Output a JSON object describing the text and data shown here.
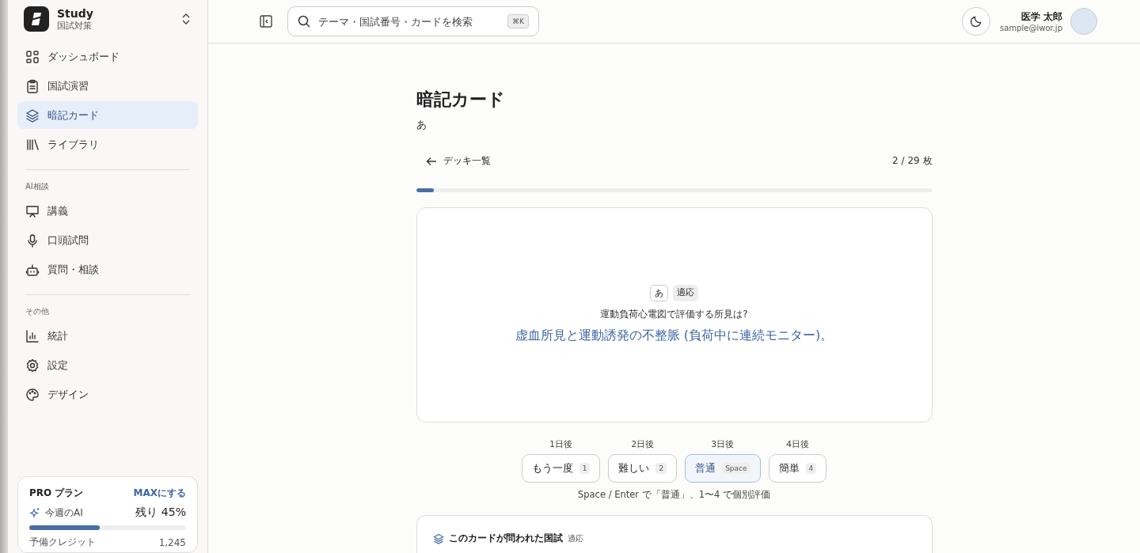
{
  "workspace": {
    "name": "Study",
    "subtitle": "国試対策"
  },
  "sidebar": {
    "sections": [
      {
        "items": [
          {
            "label": "ダッシュボード",
            "selected": false
          },
          {
            "label": "国試演習",
            "selected": false
          },
          {
            "label": "暗記カード",
            "selected": true
          },
          {
            "label": "ライブラリ",
            "selected": false
          }
        ]
      },
      {
        "heading": "AI相談",
        "items": [
          {
            "label": "講義",
            "selected": false
          },
          {
            "label": "口頭試問",
            "selected": false
          },
          {
            "label": "質問・相談",
            "selected": false
          }
        ]
      },
      {
        "heading": "その他",
        "items": [
          {
            "label": "統計",
            "selected": false
          },
          {
            "label": "設定",
            "selected": false
          },
          {
            "label": "デザイン",
            "selected": false
          }
        ]
      }
    ],
    "plan": {
      "name": "PRO プラン",
      "upgrade": "MAXにする",
      "ai_label": "今週のAI",
      "remaining": "残り 45%",
      "level": 0.45,
      "credit_label": "予備クレジット",
      "credit_value": "1,245"
    }
  },
  "topbar": {
    "search": {
      "placeholder": "テーマ・国試番号・カードを検索",
      "shortcut": "⌘K"
    },
    "user": {
      "name": "医学 太郎",
      "email": "sample@iwor.jp"
    }
  },
  "page": {
    "title": "暗記カード",
    "subtitle": "あ",
    "back": "デッキ一覧",
    "counter": "2 / 29 枚",
    "progress": {
      "level": 0.034
    }
  },
  "card": {
    "tags": [
      "あ",
      "適応"
    ],
    "question": "運動負荷心電図で評価する所見は?",
    "answer": "虚血所見と運動誘発の不整脈 (負荷中に連続モニター)。"
  },
  "ratings": [
    {
      "interval": "1日後",
      "label": "もう一度",
      "key": "1",
      "selected": false
    },
    {
      "interval": "2日後",
      "label": "難しい",
      "key": "2",
      "selected": false
    },
    {
      "interval": "3日後",
      "label": "普通",
      "key": "Space",
      "selected": true
    },
    {
      "interval": "4日後",
      "label": "簡単",
      "key": "4",
      "selected": false
    }
  ],
  "hint": "Space / Enter で「普通」、1〜4 で個別評価",
  "exam_panel": {
    "title": "このカードが問われた国試",
    "tag": "適応"
  }
}
